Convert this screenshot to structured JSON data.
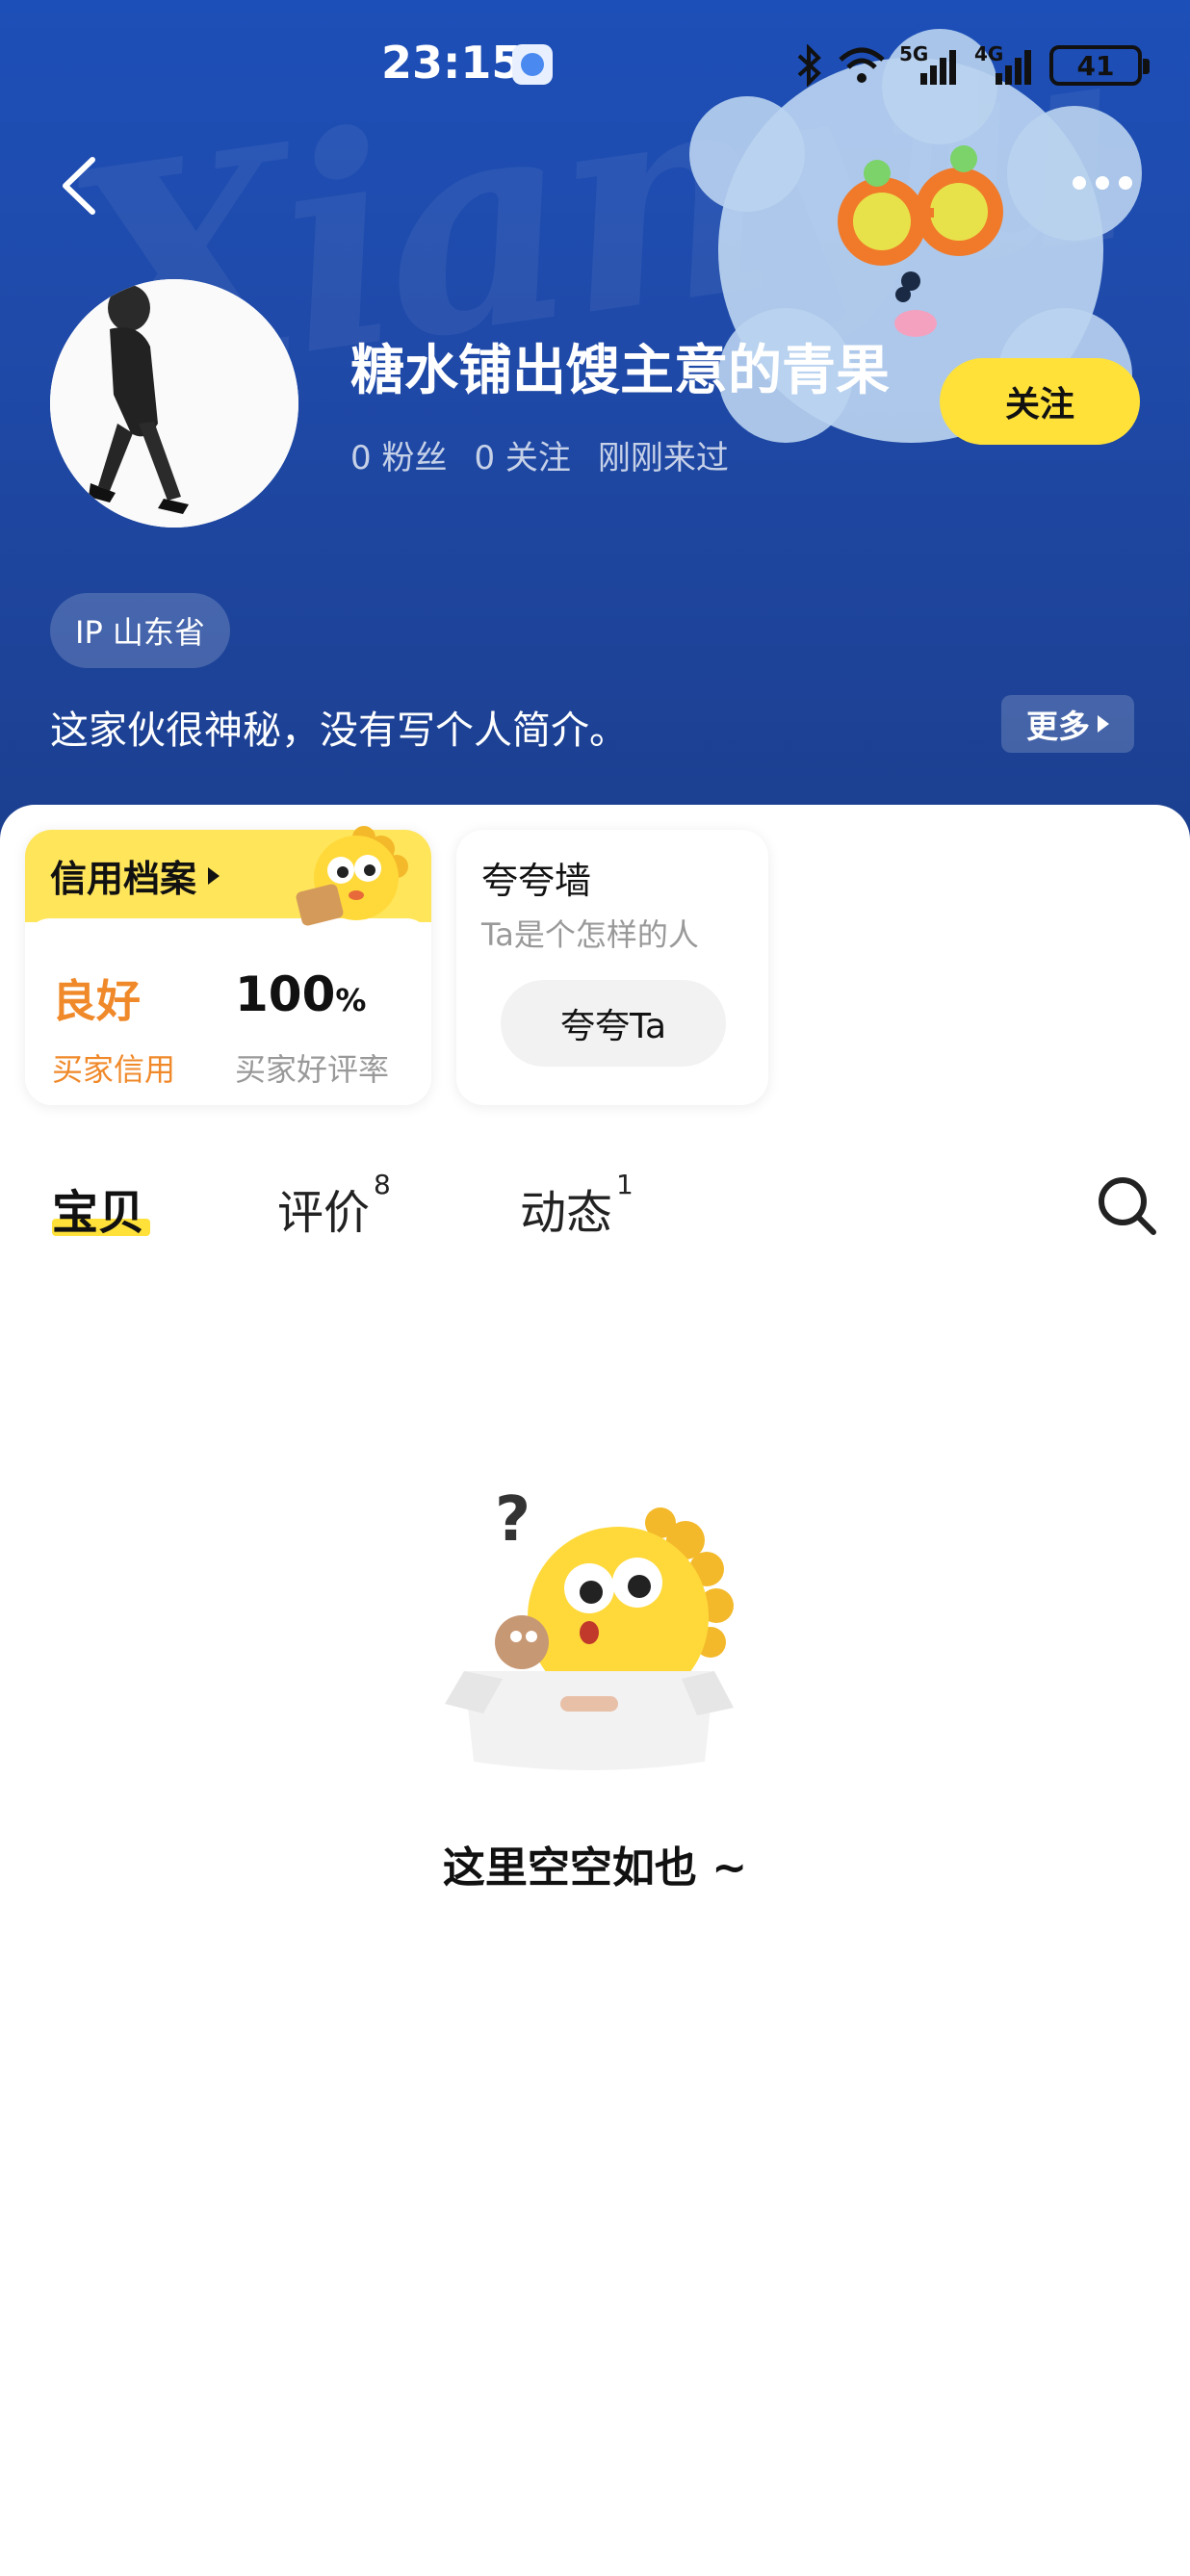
{
  "status_bar": {
    "time": "23:15",
    "battery": "41",
    "network_1": "5G",
    "network_2": "4G"
  },
  "header": {
    "watermark": "Xianyu",
    "username": "糖水铺出馊主意的青果",
    "stats": {
      "fans": "0 粉丝",
      "following": "0 关注",
      "last_seen": "刚刚来过"
    },
    "follow_label": "关注",
    "ip_location": "IP 山东省",
    "bio": "这家伙很神秘，没有写个人简介。",
    "bio_more_label": "更多"
  },
  "credit_card": {
    "title": "信用档案",
    "level": "良好",
    "level_label": "买家信用",
    "rate_value": "100",
    "rate_unit": "%",
    "rate_label": "买家好评率"
  },
  "praise_card": {
    "title": "夸夸墙",
    "subtitle": "Ta是个怎样的人",
    "button_label": "夸夸Ta"
  },
  "tabs": [
    {
      "label": "宝贝",
      "count": ""
    },
    {
      "label": "评价",
      "count": "8"
    },
    {
      "label": "动态",
      "count": "1"
    }
  ],
  "empty_state": {
    "message": "这里空空如也 ~"
  },
  "colors": {
    "header_bg": "#1f4aa9",
    "accent_yellow": "#ffe13a",
    "credit_orange": "#f0892a"
  }
}
